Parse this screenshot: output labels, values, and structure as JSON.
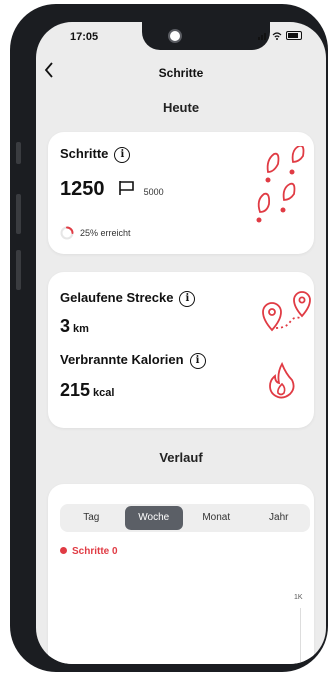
{
  "status_bar": {
    "time": "17:05"
  },
  "nav": {
    "title": "Schritte"
  },
  "today": {
    "heading": "Heute",
    "steps": {
      "label": "Schritte",
      "value": "1250",
      "goal": "5000",
      "progress_text": "25% erreicht",
      "progress_fraction": 0.25
    },
    "distance": {
      "label": "Gelaufene Strecke",
      "value": "3",
      "unit": "km"
    },
    "calories": {
      "label": "Verbrannte Kalorien",
      "value": "215",
      "unit": "kcal"
    }
  },
  "history": {
    "heading": "Verlauf",
    "tabs": [
      "Tag",
      "Woche",
      "Monat",
      "Jahr"
    ],
    "active_tab": "Woche",
    "legend": "Schritte 0",
    "axis_label": "1K"
  },
  "colors": {
    "accent": "#e03b44",
    "tab_active": "#5b5f66"
  },
  "icons": {
    "back": "chevron-left-icon",
    "info": "info-icon",
    "goal": "flag-icon",
    "steps_decor": "footprints-icon",
    "distance_decor": "route-pins-icon",
    "calories_decor": "flame-icon"
  }
}
